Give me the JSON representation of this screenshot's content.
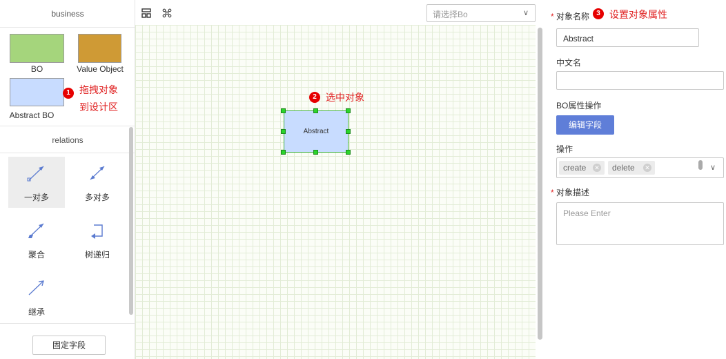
{
  "left_panel": {
    "business_title": "business",
    "business_shapes": [
      {
        "label": "BO",
        "color": "#a5d57c"
      },
      {
        "label": "Value Object",
        "color": "#cf9a35"
      },
      {
        "label": "Abstract BO",
        "color": "#c8dcff"
      }
    ],
    "relations_title": "relations",
    "relations": [
      {
        "label": "一对多",
        "icon": "one-to-many-arrow-icon",
        "active": true
      },
      {
        "label": "多对多",
        "icon": "many-to-many-arrow-icon",
        "active": false
      },
      {
        "label": "聚合",
        "icon": "aggregation-arrow-icon",
        "active": false
      },
      {
        "label": "树递归",
        "icon": "tree-recursion-icon",
        "active": false
      },
      {
        "label": "继承",
        "icon": "inheritance-arrow-icon",
        "active": false
      }
    ],
    "fixed_field_button": "固定字段"
  },
  "annotations": {
    "step1_num": "1",
    "step1_line1": "拖拽对象",
    "step1_line2": "到设计区",
    "step2_num": "2",
    "step2_text": "选中对象",
    "step3_num": "3",
    "step3_text": "设置对象属性",
    "color": "#e02020"
  },
  "canvas": {
    "toolbar_icons": [
      "layout-grid-icon",
      "hierarchy-tree-icon"
    ],
    "bo_select_placeholder": "请选择Bo",
    "node_label": "Abstract"
  },
  "properties": {
    "name_label": "对象名称",
    "name_value": "Abstract",
    "cn_name_label": "中文名",
    "cn_name_value": "",
    "bo_attr_label": "BO属性操作",
    "edit_field_button": "编辑字段",
    "operation_label": "操作",
    "operation_tags": [
      "create",
      "delete"
    ],
    "desc_label": "对象描述",
    "desc_placeholder": "Please Enter",
    "primary_color": "#5f7ed8"
  }
}
